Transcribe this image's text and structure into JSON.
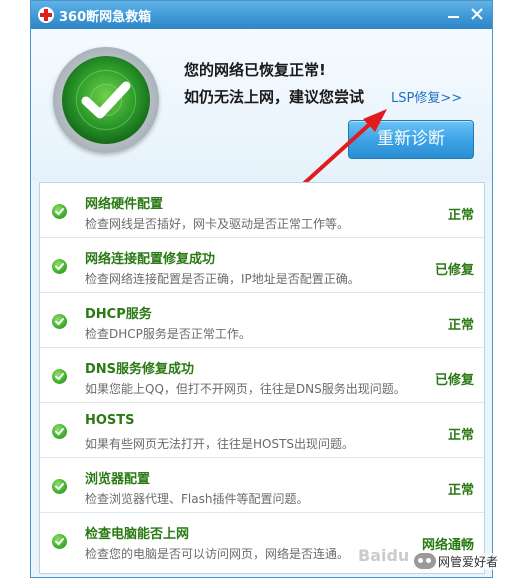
{
  "window": {
    "title": "360断网急救箱",
    "minimize_icon": "minimize-icon",
    "close_icon": "close-icon"
  },
  "header": {
    "headline": "您的网络已恢复正常!",
    "suggestion": "如仍无法上网，建议您尝试",
    "lsp_link": "LSP修复>>",
    "rediagnose_button": "重新诊断",
    "status_icon": "check-orb-icon"
  },
  "results": [
    {
      "title": "网络硬件配置",
      "desc": "检查网线是否插好，网卡及驱动是否正常工作等。",
      "status": "正常"
    },
    {
      "title": "网络连接配置修复成功",
      "desc": "检查网络连接配置是否正确，IP地址是否配置正确。",
      "status": "已修复"
    },
    {
      "title": "DHCP服务",
      "desc": "检查DHCP服务是否正常工作。",
      "status": "正常"
    },
    {
      "title": "DNS服务修复成功",
      "desc": "如果您能上QQ，但打不开网页，往往是DNS服务出现问题。",
      "status": "已修复"
    },
    {
      "title": "HOSTS",
      "desc": "如果有些网页无法打开，往往是HOSTS出现问题。",
      "status": "正常"
    },
    {
      "title": "浏览器配置",
      "desc": "检查浏览器代理、Flash插件等配置问题。",
      "status": "正常"
    },
    {
      "title": "检查电脑能否上网",
      "desc": "检查您的电脑是否可以访问网页，网络是否连通。",
      "status": "网络通畅"
    }
  ],
  "overlay": {
    "watermark": "Baidu",
    "wechat_label": "网管爱好者"
  },
  "colors": {
    "accent": "#3f98d6",
    "ok_green": "#2a7a14",
    "arrow_red": "#e01c1c"
  }
}
